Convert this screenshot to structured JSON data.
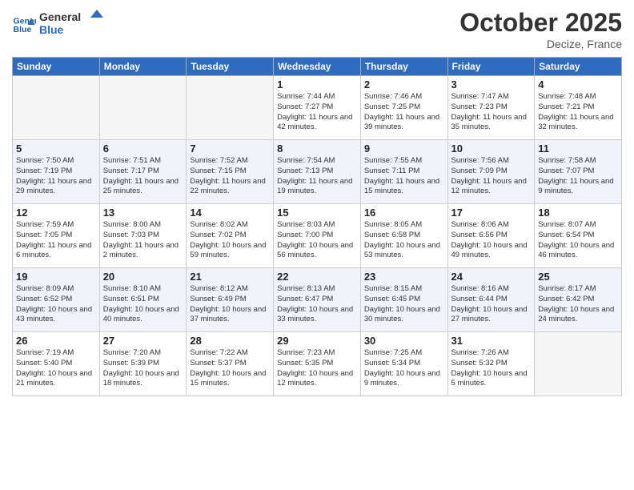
{
  "header": {
    "logo_line1": "General",
    "logo_line2": "Blue",
    "month": "October 2025",
    "location": "Decize, France"
  },
  "weekdays": [
    "Sunday",
    "Monday",
    "Tuesday",
    "Wednesday",
    "Thursday",
    "Friday",
    "Saturday"
  ],
  "weeks": [
    [
      {
        "day": "",
        "info": ""
      },
      {
        "day": "",
        "info": ""
      },
      {
        "day": "",
        "info": ""
      },
      {
        "day": "1",
        "info": "Sunrise: 7:44 AM\nSunset: 7:27 PM\nDaylight: 11 hours\nand 42 minutes."
      },
      {
        "day": "2",
        "info": "Sunrise: 7:46 AM\nSunset: 7:25 PM\nDaylight: 11 hours\nand 39 minutes."
      },
      {
        "day": "3",
        "info": "Sunrise: 7:47 AM\nSunset: 7:23 PM\nDaylight: 11 hours\nand 35 minutes."
      },
      {
        "day": "4",
        "info": "Sunrise: 7:48 AM\nSunset: 7:21 PM\nDaylight: 11 hours\nand 32 minutes."
      }
    ],
    [
      {
        "day": "5",
        "info": "Sunrise: 7:50 AM\nSunset: 7:19 PM\nDaylight: 11 hours\nand 29 minutes."
      },
      {
        "day": "6",
        "info": "Sunrise: 7:51 AM\nSunset: 7:17 PM\nDaylight: 11 hours\nand 25 minutes."
      },
      {
        "day": "7",
        "info": "Sunrise: 7:52 AM\nSunset: 7:15 PM\nDaylight: 11 hours\nand 22 minutes."
      },
      {
        "day": "8",
        "info": "Sunrise: 7:54 AM\nSunset: 7:13 PM\nDaylight: 11 hours\nand 19 minutes."
      },
      {
        "day": "9",
        "info": "Sunrise: 7:55 AM\nSunset: 7:11 PM\nDaylight: 11 hours\nand 15 minutes."
      },
      {
        "day": "10",
        "info": "Sunrise: 7:56 AM\nSunset: 7:09 PM\nDaylight: 11 hours\nand 12 minutes."
      },
      {
        "day": "11",
        "info": "Sunrise: 7:58 AM\nSunset: 7:07 PM\nDaylight: 11 hours\nand 9 minutes."
      }
    ],
    [
      {
        "day": "12",
        "info": "Sunrise: 7:59 AM\nSunset: 7:05 PM\nDaylight: 11 hours\nand 6 minutes."
      },
      {
        "day": "13",
        "info": "Sunrise: 8:00 AM\nSunset: 7:03 PM\nDaylight: 11 hours\nand 2 minutes."
      },
      {
        "day": "14",
        "info": "Sunrise: 8:02 AM\nSunset: 7:02 PM\nDaylight: 10 hours\nand 59 minutes."
      },
      {
        "day": "15",
        "info": "Sunrise: 8:03 AM\nSunset: 7:00 PM\nDaylight: 10 hours\nand 56 minutes."
      },
      {
        "day": "16",
        "info": "Sunrise: 8:05 AM\nSunset: 6:58 PM\nDaylight: 10 hours\nand 53 minutes."
      },
      {
        "day": "17",
        "info": "Sunrise: 8:06 AM\nSunset: 6:56 PM\nDaylight: 10 hours\nand 49 minutes."
      },
      {
        "day": "18",
        "info": "Sunrise: 8:07 AM\nSunset: 6:54 PM\nDaylight: 10 hours\nand 46 minutes."
      }
    ],
    [
      {
        "day": "19",
        "info": "Sunrise: 8:09 AM\nSunset: 6:52 PM\nDaylight: 10 hours\nand 43 minutes."
      },
      {
        "day": "20",
        "info": "Sunrise: 8:10 AM\nSunset: 6:51 PM\nDaylight: 10 hours\nand 40 minutes."
      },
      {
        "day": "21",
        "info": "Sunrise: 8:12 AM\nSunset: 6:49 PM\nDaylight: 10 hours\nand 37 minutes."
      },
      {
        "day": "22",
        "info": "Sunrise: 8:13 AM\nSunset: 6:47 PM\nDaylight: 10 hours\nand 33 minutes."
      },
      {
        "day": "23",
        "info": "Sunrise: 8:15 AM\nSunset: 6:45 PM\nDaylight: 10 hours\nand 30 minutes."
      },
      {
        "day": "24",
        "info": "Sunrise: 8:16 AM\nSunset: 6:44 PM\nDaylight: 10 hours\nand 27 minutes."
      },
      {
        "day": "25",
        "info": "Sunrise: 8:17 AM\nSunset: 6:42 PM\nDaylight: 10 hours\nand 24 minutes."
      }
    ],
    [
      {
        "day": "26",
        "info": "Sunrise: 7:19 AM\nSunset: 5:40 PM\nDaylight: 10 hours\nand 21 minutes."
      },
      {
        "day": "27",
        "info": "Sunrise: 7:20 AM\nSunset: 5:39 PM\nDaylight: 10 hours\nand 18 minutes."
      },
      {
        "day": "28",
        "info": "Sunrise: 7:22 AM\nSunset: 5:37 PM\nDaylight: 10 hours\nand 15 minutes."
      },
      {
        "day": "29",
        "info": "Sunrise: 7:23 AM\nSunset: 5:35 PM\nDaylight: 10 hours\nand 12 minutes."
      },
      {
        "day": "30",
        "info": "Sunrise: 7:25 AM\nSunset: 5:34 PM\nDaylight: 10 hours\nand 9 minutes."
      },
      {
        "day": "31",
        "info": "Sunrise: 7:26 AM\nSunset: 5:32 PM\nDaylight: 10 hours\nand 5 minutes."
      },
      {
        "day": "",
        "info": ""
      }
    ]
  ]
}
